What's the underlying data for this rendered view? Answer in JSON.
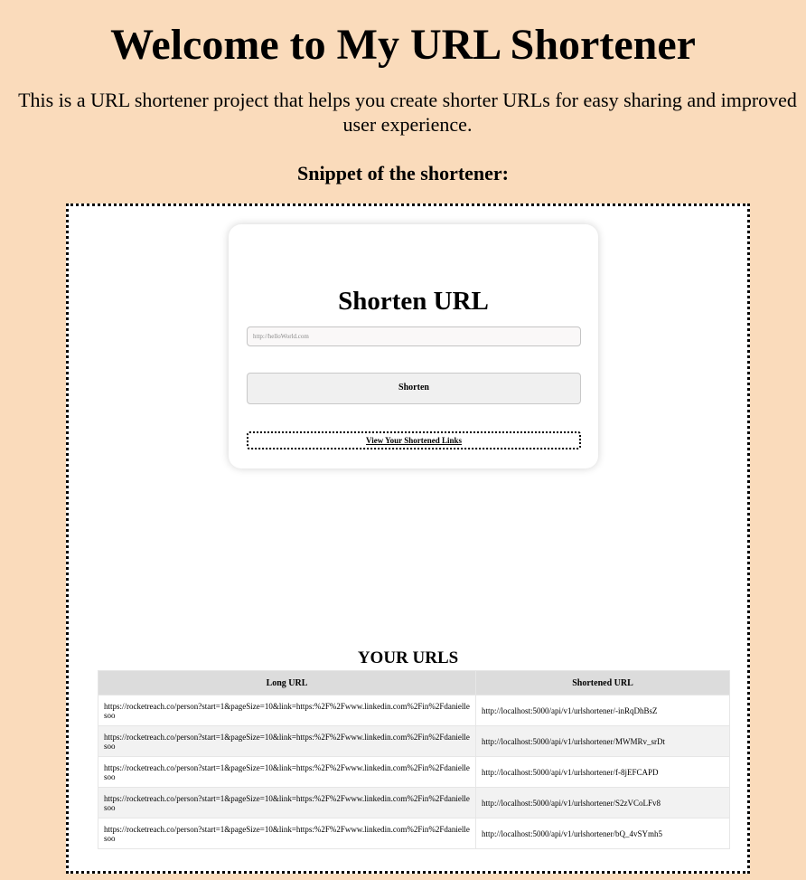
{
  "page": {
    "title": "Welcome to My URL Shortener",
    "intro": "This is a URL shortener project that helps you create shorter URLs for easy sharing and improved user experience.",
    "snippet_heading": "Snippet of the shortener:"
  },
  "colors": {
    "page_background": "#fadbbb",
    "frame_background": "#ffffff",
    "table_header": "#dcdcdc",
    "row_alt": "#f2f2f2"
  },
  "shortener": {
    "title": "Shorten URL",
    "input_placeholder": "http://helloWorld.com",
    "input_value": "",
    "shorten_label": "Shorten",
    "view_links_label": "View Your Shortened Links"
  },
  "urls": {
    "heading": "YOUR URLS",
    "columns": [
      "Long URL",
      "Shortened URL"
    ],
    "rows": [
      {
        "long": "https://rocketreach.co/person?start=1&pageSize=10&link=https:%2F%2Fwww.linkedin.com%2Fin%2Fdaniellesoo",
        "short": "http://localhost:5000/api/v1/urlshortener/-inRqDhBsZ"
      },
      {
        "long": "https://rocketreach.co/person?start=1&pageSize=10&link=https:%2F%2Fwww.linkedin.com%2Fin%2Fdaniellesoo",
        "short": "http://localhost:5000/api/v1/urlshortener/MWMRv_srDt"
      },
      {
        "long": "https://rocketreach.co/person?start=1&pageSize=10&link=https:%2F%2Fwww.linkedin.com%2Fin%2Fdaniellesoo",
        "short": "http://localhost:5000/api/v1/urlshortener/f-8jEFCAPD"
      },
      {
        "long": "https://rocketreach.co/person?start=1&pageSize=10&link=https:%2F%2Fwww.linkedin.com%2Fin%2Fdaniellesoo",
        "short": "http://localhost:5000/api/v1/urlshortener/S2zVCoLFv8"
      },
      {
        "long": "https://rocketreach.co/person?start=1&pageSize=10&link=https:%2F%2Fwww.linkedin.com%2Fin%2Fdaniellesoo",
        "short": "http://localhost:5000/api/v1/urlshortener/bQ_4vSYmh5"
      }
    ]
  }
}
